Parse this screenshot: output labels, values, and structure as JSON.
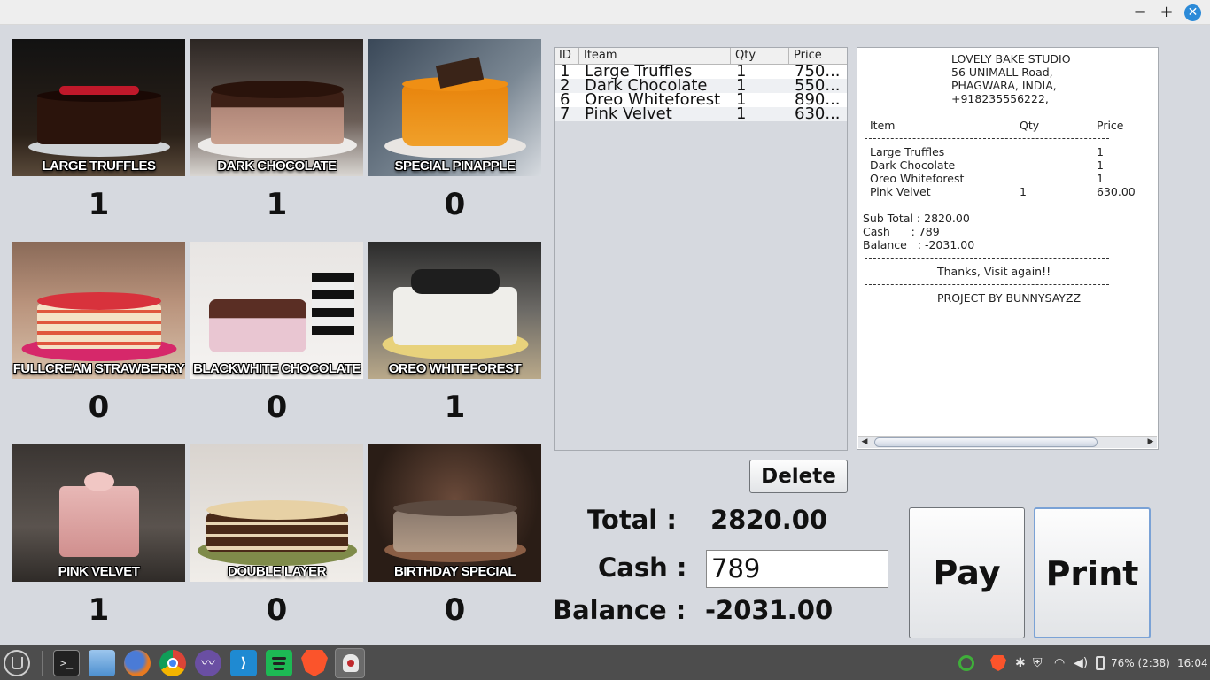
{
  "window": {
    "minimize": "−",
    "maximize": "+",
    "close": "✕"
  },
  "products": [
    {
      "name": "LARGE TRUFFLES",
      "qty": "1"
    },
    {
      "name": "DARK CHOCOLATE",
      "qty": "1"
    },
    {
      "name": "SPECIAL PINAPPLE",
      "qty": "0"
    },
    {
      "name": "FULLCREAM STRAWBERRY",
      "qty": "0"
    },
    {
      "name": "BLACKWHITE CHOCOLATE",
      "qty": "0"
    },
    {
      "name": "OREO WHITEFOREST",
      "qty": "1"
    },
    {
      "name": "PINK VELVET",
      "qty": "1"
    },
    {
      "name": "DOUBLE LAYER",
      "qty": "0"
    },
    {
      "name": "BIRTHDAY SPECIAL",
      "qty": "0"
    }
  ],
  "table": {
    "headers": {
      "id": "ID",
      "item": "Iteam",
      "qty": "Qty",
      "price": "Price"
    },
    "rows": [
      {
        "id": "1",
        "item": "Large Truffles",
        "qty": "1",
        "price": "750..."
      },
      {
        "id": "2",
        "item": "Dark Chocolate",
        "qty": "1",
        "price": "550..."
      },
      {
        "id": "6",
        "item": "Oreo Whiteforest",
        "qty": "1",
        "price": "890..."
      },
      {
        "id": "7",
        "item": "Pink Velvet",
        "qty": "1",
        "price": "630..."
      }
    ]
  },
  "receipt": {
    "shop_name": "LOVELY BAKE STUDIO",
    "address1": "56 UNIMALL Road,",
    "address2": "PHAGWARA, INDIA,",
    "phone": "+918235556222,",
    "col_item": "Item",
    "col_qty": "Qty",
    "col_price": "Price",
    "items": [
      {
        "item": "Large Truffles",
        "qty": "",
        "price": "1"
      },
      {
        "item": "Dark Chocolate",
        "qty": "",
        "price": "1"
      },
      {
        "item": "Oreo Whiteforest",
        "qty": "",
        "price": "1"
      },
      {
        "item": "Pink Velvet",
        "qty": "1",
        "price": "630.00"
      }
    ],
    "subtotal": "Sub Total : 2820.00",
    "cash": "Cash      : 789",
    "balance": "Balance   : -2031.00",
    "thanks": "Thanks, Visit again!!",
    "credit": "PROJECT BY BUNNYSAYZZ"
  },
  "buttons": {
    "delete": "Delete",
    "pay": "Pay",
    "print": "Print"
  },
  "totals": {
    "total_label": "Total :",
    "total_value": "2820.00",
    "cash_label": "Cash :",
    "cash_value": "789",
    "balance_label": "Balance :",
    "balance_value": "-2031.00"
  },
  "taskbar": {
    "icons": [
      "menu-icon",
      "terminal-icon",
      "files-icon",
      "firefox-icon",
      "chrome-icon",
      "mustache-app-icon",
      "vscode-icon",
      "spotify-icon",
      "brave-icon",
      "java-icon"
    ],
    "battery": "76% (2:38)",
    "clock": "16:04"
  },
  "colors": {
    "accent": "#2b8ad8",
    "background": "#d6d9df",
    "taskbar": "#4d4d4d"
  }
}
